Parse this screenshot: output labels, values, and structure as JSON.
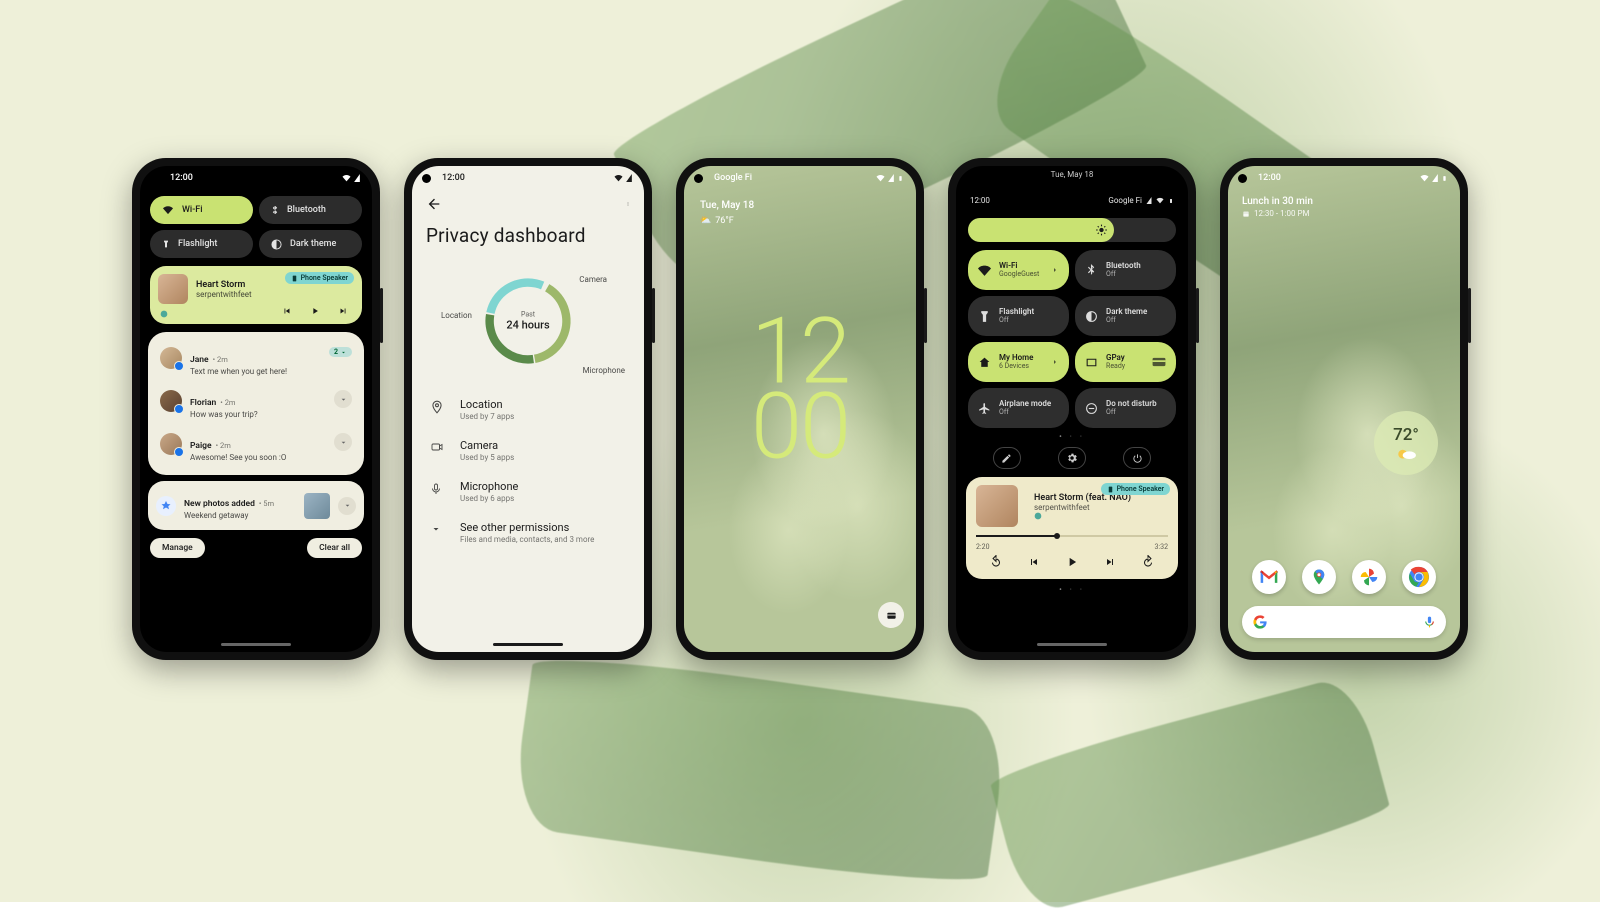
{
  "phone1": {
    "time": "12:00",
    "qs": [
      {
        "label": "Wi-Fi",
        "on": true,
        "icon": "wifi"
      },
      {
        "label": "Bluetooth",
        "on": false,
        "icon": "bluetooth"
      },
      {
        "label": "Flashlight",
        "on": false,
        "icon": "flashlight"
      },
      {
        "label": "Dark theme",
        "on": false,
        "icon": "dark"
      }
    ],
    "media": {
      "title": "Heart Storm",
      "artist": "serpentwithfeet",
      "chip": "Phone Speaker"
    },
    "convos": [
      {
        "name": "Jane",
        "meta": "2m",
        "body": "Text me when you get here!",
        "count": "2"
      },
      {
        "name": "Florian",
        "meta": "2m",
        "body": "How was your trip?"
      },
      {
        "name": "Paige",
        "meta": "2m",
        "body": "Awesome! See you soon :O"
      }
    ],
    "photos": {
      "title": "New photos added",
      "meta": "5m",
      "body": "Weekend getaway"
    },
    "manage": "Manage",
    "clear": "Clear all"
  },
  "phone2": {
    "time": "12:00",
    "title": "Privacy dashboard",
    "donut": {
      "past": "Past",
      "range": "24 hours",
      "labels": {
        "camera": "Camera",
        "mic": "Microphone",
        "loc": "Location"
      }
    },
    "rows": [
      {
        "t": "Location",
        "s": "Used by 7 apps",
        "icon": "location"
      },
      {
        "t": "Camera",
        "s": "Used by 5 apps",
        "icon": "camera"
      },
      {
        "t": "Microphone",
        "s": "Used by 6 apps",
        "icon": "mic"
      },
      {
        "t": "See other permissions",
        "s": "Files and media, contacts, and 3 more",
        "icon": "expand"
      }
    ]
  },
  "phone3": {
    "carrier": "Google Fi",
    "date": "Tue, May 18",
    "temp": "76°F",
    "clock_h": "12",
    "clock_m": "00"
  },
  "phone4": {
    "date": "Tue, May 18",
    "time": "12:00",
    "carrier": "Google Fi",
    "tiles": [
      {
        "t": "Wi-Fi",
        "s": "GoogleGuest",
        "on": true,
        "icon": "wifi",
        "arrow": true
      },
      {
        "t": "Bluetooth",
        "s": "Off",
        "on": false,
        "icon": "bluetooth"
      },
      {
        "t": "Flashlight",
        "s": "Off",
        "on": false,
        "icon": "flashlight"
      },
      {
        "t": "Dark theme",
        "s": "Off",
        "on": false,
        "icon": "dark"
      },
      {
        "t": "My Home",
        "s": "6 Devices",
        "on": true,
        "icon": "home",
        "arrow": true
      },
      {
        "t": "GPay",
        "s": "Ready",
        "on": true,
        "icon": "gpay",
        "card": true
      },
      {
        "t": "Airplane mode",
        "s": "Off",
        "on": false,
        "icon": "airplane"
      },
      {
        "t": "Do not disturb",
        "s": "Off",
        "on": false,
        "icon": "dnd"
      }
    ],
    "media": {
      "title": "Heart Storm (feat. NAO)",
      "artist": "serpentwithfeet",
      "chip": "Phone Speaker",
      "elapsed": "2:20",
      "total": "3:32"
    }
  },
  "phone5": {
    "time": "12:00",
    "event": "Lunch in 30 min",
    "event_time": "12:30 - 1:00 PM",
    "temp": "72°",
    "apps": [
      "gmail",
      "maps",
      "photos",
      "chrome"
    ]
  }
}
